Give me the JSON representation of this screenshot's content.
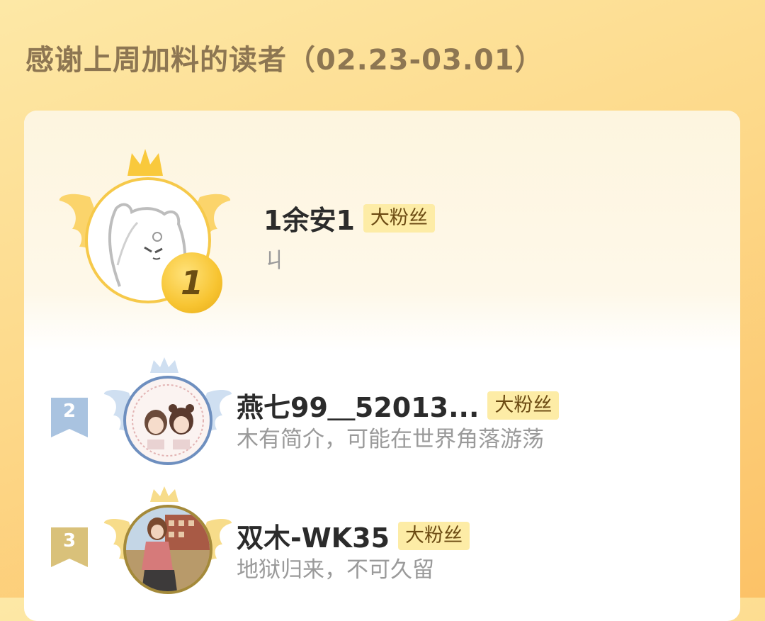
{
  "header": {
    "title": "感谢上周加料的读者（02.23-03.01）"
  },
  "readers": [
    {
      "rank": "1",
      "name": "1余安1",
      "badge": "大粉丝",
      "bio": "ㄐ"
    },
    {
      "rank": "2",
      "name": "燕七99＿52013...",
      "badge": "大粉丝",
      "bio": "木有简介，可能在世界角落游荡"
    },
    {
      "rank": "3",
      "name": "双木-WK35",
      "badge": "大粉丝",
      "bio": "地狱归来，不可久留"
    }
  ],
  "colors": {
    "gold": "#f7c431",
    "silver_flag": "#a9c3e0",
    "bronze_flag": "#d9c17a",
    "badge_bg": "#fdeca6"
  }
}
